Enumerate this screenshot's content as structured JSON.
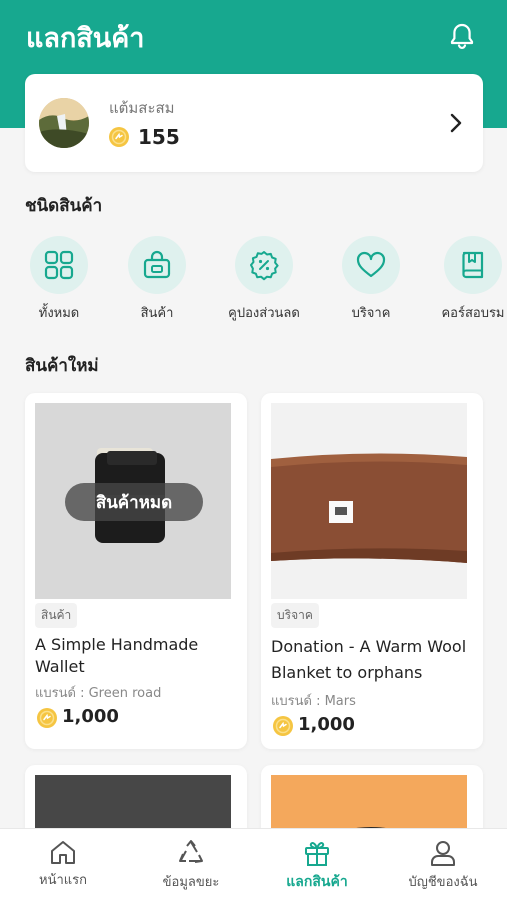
{
  "header": {
    "title": "แลกสินค้า",
    "icon": "bell-icon"
  },
  "points": {
    "label": "แต้มสะสม",
    "value": "155",
    "icon": "coin-icon"
  },
  "categories": {
    "title": "ชนิดสินค้า",
    "items": [
      {
        "label": "ทั้งหมด",
        "icon": "grid-icon"
      },
      {
        "label": "สินค้า",
        "icon": "shopping-bag-icon"
      },
      {
        "label": "คูปองส่วนลด",
        "icon": "discount-coupon-icon"
      },
      {
        "label": "บริจาค",
        "icon": "heart-icon"
      },
      {
        "label": "คอร์สอบรม",
        "icon": "book-icon"
      }
    ]
  },
  "new_products": {
    "title": "สินค้าใหม่",
    "items": [
      {
        "tag": "สินค้า",
        "name": "A Simple Handmade Wallet",
        "brand": "แบรนด์ : Green road",
        "price": "1,000",
        "badge": "สินค้าหมด"
      },
      {
        "tag": "บริจาค",
        "name": "Donation - A Warm Wool Blanket to orphans",
        "brand": "แบรนด์ : Mars",
        "price": "1,000"
      }
    ]
  },
  "bottom_nav": {
    "items": [
      {
        "label": "หน้าแรก",
        "icon": "home-icon"
      },
      {
        "label": "ข้อมูลขยะ",
        "icon": "recycle-icon"
      },
      {
        "label": "แลกสินค้า",
        "icon": "gift-icon",
        "active": true
      },
      {
        "label": "บัญชีของฉัน",
        "icon": "user-icon"
      }
    ]
  },
  "colors": {
    "primary": "#17a88f",
    "category_bg": "#dff1ee",
    "coin": "#f5c542"
  }
}
